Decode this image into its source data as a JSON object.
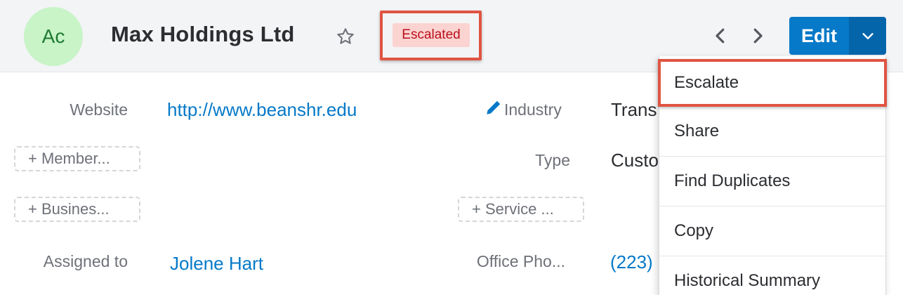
{
  "header": {
    "avatar_initials": "Ac",
    "title": "Max Holdings Ltd",
    "status_badge": "Escalated",
    "edit_label": "Edit"
  },
  "fields": {
    "website_label": "Website",
    "website_value": "http://www.beanshr.edu",
    "industry_label": "Industry",
    "industry_value": "Trans",
    "member_button": "+ Member...",
    "type_label": "Type",
    "type_value": "Custo",
    "business_button": "+ Busines...",
    "service_button": "+ Service ...",
    "assigned_label": "Assigned to",
    "assigned_value": "Jolene Hart",
    "office_phone_label": "Office Pho...",
    "office_phone_value": "(223)"
  },
  "dropdown": {
    "items": [
      "Escalate",
      "Share",
      "Find Duplicates",
      "Copy",
      "Historical Summary"
    ]
  },
  "colors": {
    "accent": "#0679c8",
    "badge_bg": "#fbd3d0",
    "badge_text": "#bb0e1b",
    "highlight_outline": "#e05442",
    "avatar_bg": "#c8f4c8"
  }
}
